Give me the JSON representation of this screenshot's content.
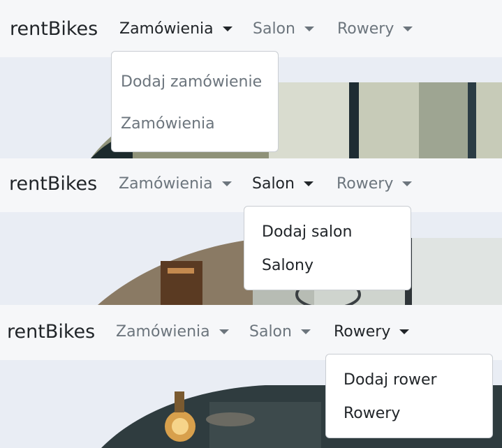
{
  "brand": "rentBikes",
  "nav": {
    "orders": "Zamówienia",
    "salon": "Salon",
    "bikes": "Rowery"
  },
  "menus": {
    "orders": [
      "Dodaj zamówienie",
      "Zamówienia"
    ],
    "salon": [
      "Dodaj salon",
      "Salony"
    ],
    "bikes": [
      "Dodaj rower",
      "Rowery"
    ]
  },
  "colors": {
    "navbar_bg": "#f6f7f9",
    "page_bg": "#e9edf4",
    "text_dark": "#212529",
    "text_muted": "#6c757d"
  }
}
